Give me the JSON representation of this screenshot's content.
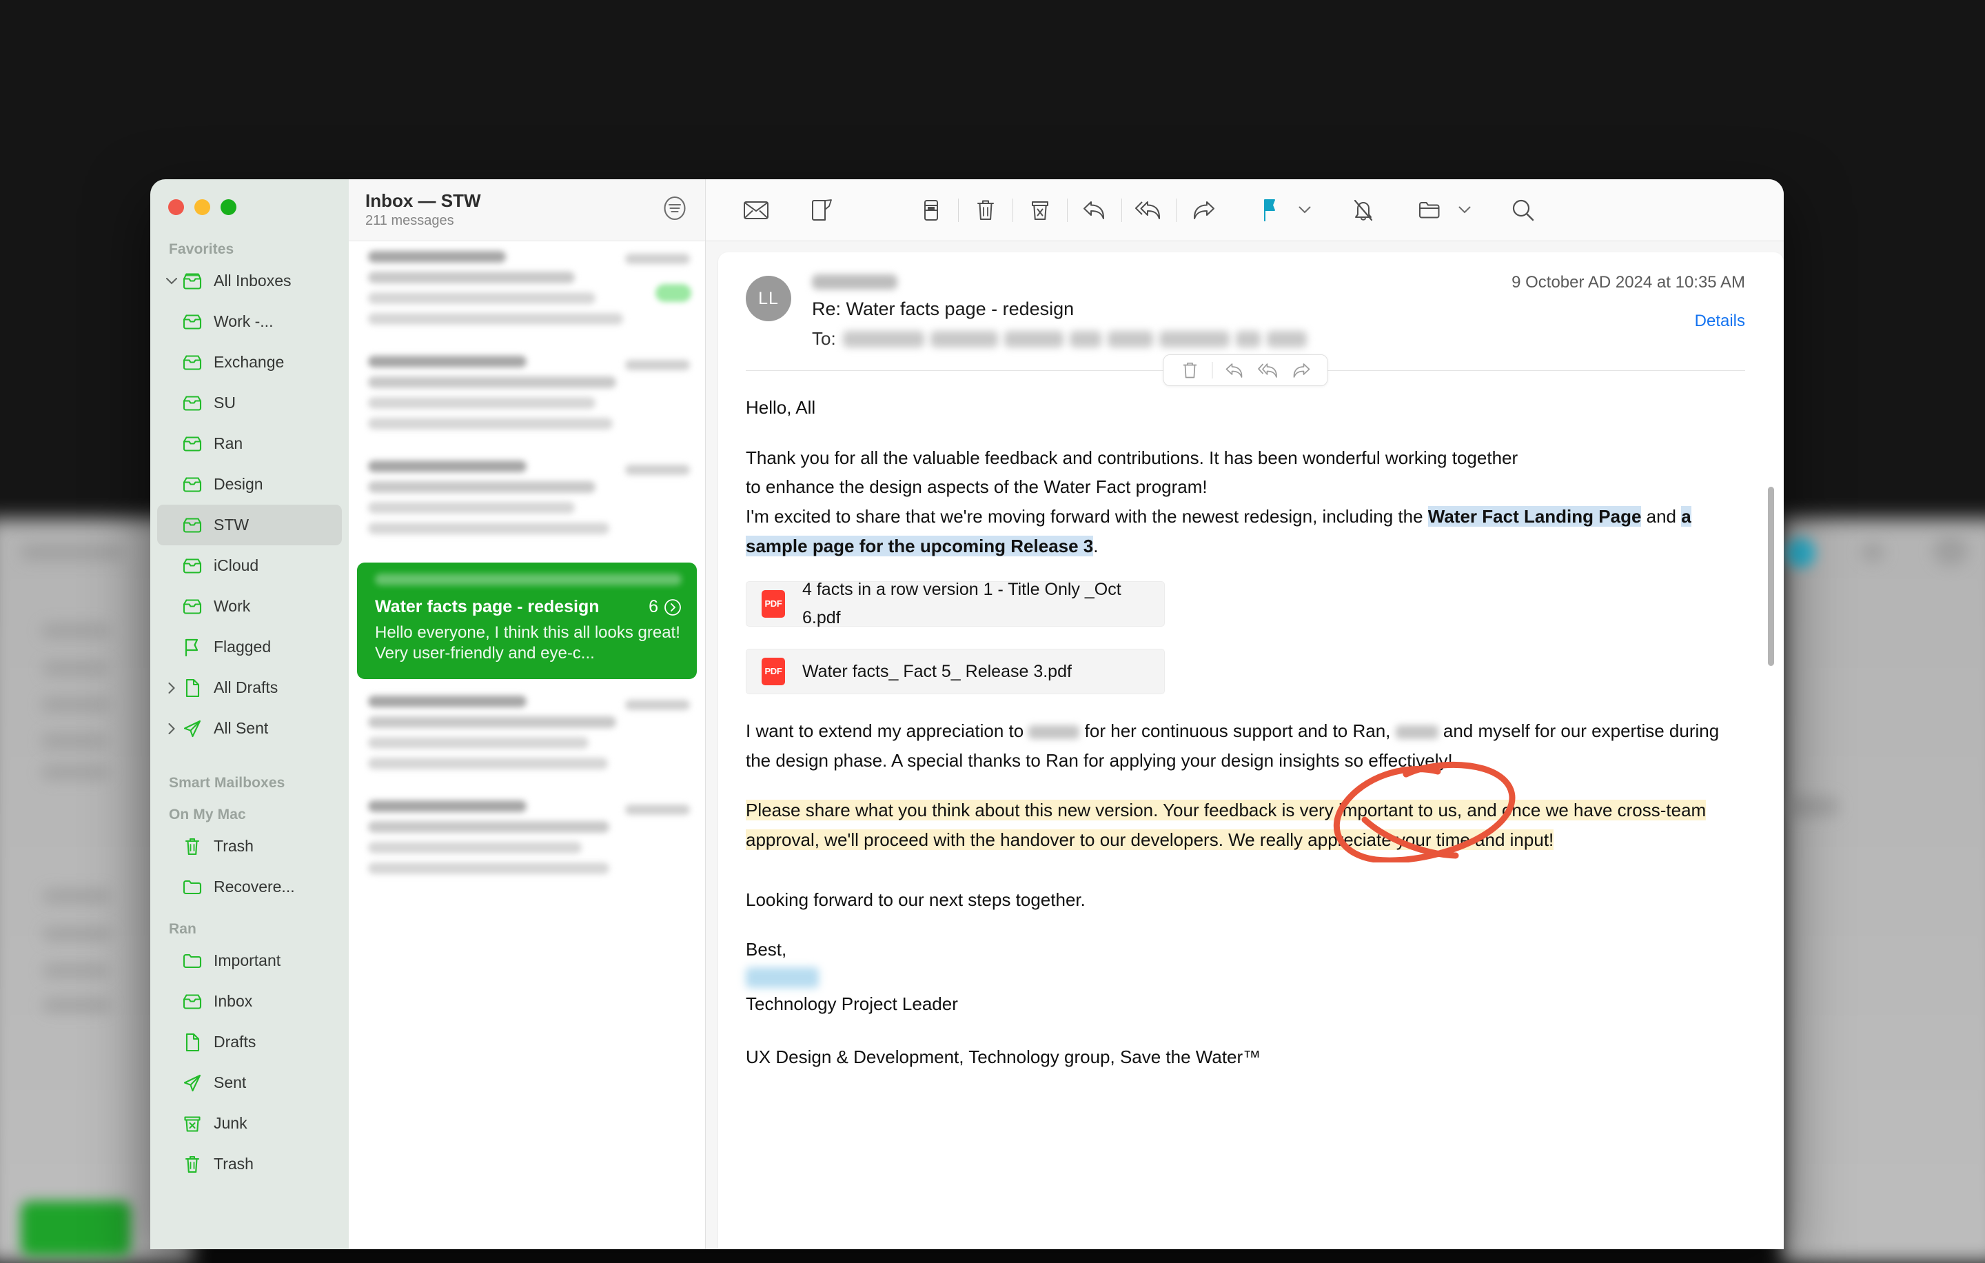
{
  "window": {
    "traffic_lights": [
      "close",
      "minimize",
      "zoom"
    ]
  },
  "sidebar": {
    "sections": [
      {
        "label": "Favorites",
        "items": [
          {
            "label": "All Inboxes",
            "icon": "inbox-icon",
            "disclosure": "chevron-down",
            "indent": 0,
            "selected": false
          },
          {
            "label": "Work -...",
            "icon": "inbox-icon",
            "disclosure": "",
            "indent": 1,
            "selected": false
          },
          {
            "label": "Exchange",
            "icon": "inbox-icon",
            "disclosure": "",
            "indent": 1,
            "selected": false
          },
          {
            "label": "SU",
            "icon": "inbox-icon",
            "disclosure": "",
            "indent": 1,
            "selected": false
          },
          {
            "label": "Ran",
            "icon": "inbox-icon",
            "disclosure": "",
            "indent": 1,
            "selected": false
          },
          {
            "label": "Design",
            "icon": "inbox-icon",
            "disclosure": "",
            "indent": 1,
            "selected": false
          },
          {
            "label": "STW",
            "icon": "inbox-icon",
            "disclosure": "",
            "indent": 1,
            "selected": true
          },
          {
            "label": "iCloud",
            "icon": "inbox-icon",
            "disclosure": "",
            "indent": 1,
            "selected": false
          },
          {
            "label": "Work",
            "icon": "inbox-icon",
            "disclosure": "",
            "indent": 1,
            "selected": false
          },
          {
            "label": "Flagged",
            "icon": "flag-icon",
            "disclosure": "",
            "indent": 0,
            "selected": false
          },
          {
            "label": "All Drafts",
            "icon": "document-icon",
            "disclosure": "chevron-right",
            "indent": 0,
            "selected": false
          },
          {
            "label": "All Sent",
            "icon": "paper-plane-icon",
            "disclosure": "chevron-right",
            "indent": 0,
            "selected": false
          }
        ]
      },
      {
        "label": "Smart Mailboxes",
        "items": []
      },
      {
        "label": "On My Mac",
        "items": [
          {
            "label": "Trash",
            "icon": "trash-icon",
            "disclosure": "",
            "indent": 0,
            "selected": false
          },
          {
            "label": "Recovere...",
            "icon": "folder-icon",
            "disclosure": "",
            "indent": 0,
            "selected": false
          }
        ]
      },
      {
        "label": "Ran",
        "items": [
          {
            "label": "Important",
            "icon": "folder-icon",
            "disclosure": "",
            "indent": 0,
            "selected": false
          },
          {
            "label": "Inbox",
            "icon": "inbox-icon",
            "disclosure": "",
            "indent": 0,
            "selected": false
          },
          {
            "label": "Drafts",
            "icon": "document-icon",
            "disclosure": "",
            "indent": 0,
            "selected": false
          },
          {
            "label": "Sent",
            "icon": "paper-plane-icon",
            "disclosure": "",
            "indent": 0,
            "selected": false
          },
          {
            "label": "Junk",
            "icon": "junk-icon",
            "disclosure": "",
            "indent": 0,
            "selected": false
          },
          {
            "label": "Trash",
            "icon": "trash-icon",
            "disclosure": "",
            "indent": 0,
            "selected": false
          }
        ]
      }
    ]
  },
  "message_list": {
    "title": "Inbox — STW",
    "subtitle": "211 messages",
    "filter_icon": "filter-icon",
    "selected_message": {
      "subject": "Water facts page - redesign",
      "thread_count": "6",
      "preview": "Hello everyone, I think this all looks great! Very user-friendly and eye-c...",
      "background_color": "#1aa524"
    }
  },
  "toolbar": {
    "buttons": [
      {
        "name": "mark-unread-icon",
        "title": "Mark as Unread"
      },
      {
        "name": "compose-icon",
        "title": "New Message"
      },
      {
        "name": "archive-icon",
        "title": "Archive"
      },
      {
        "name": "delete-icon",
        "title": "Delete"
      },
      {
        "name": "junk-icon",
        "title": "Move to Junk"
      },
      {
        "name": "reply-icon",
        "title": "Reply"
      },
      {
        "name": "reply-all-icon",
        "title": "Reply All"
      },
      {
        "name": "forward-icon",
        "title": "Forward"
      },
      {
        "name": "flag-icon",
        "title": "Flag"
      },
      {
        "name": "chevron-down-icon",
        "title": "Flag options"
      },
      {
        "name": "mute-icon",
        "title": "Mute"
      },
      {
        "name": "move-to-folder-icon",
        "title": "Move"
      },
      {
        "name": "search-icon",
        "title": "Search"
      }
    ],
    "flag_color": "#11a2c4"
  },
  "email": {
    "avatar_initials": "LL",
    "subject": "Re: Water facts page - redesign",
    "to_label": "To:",
    "timestamp": "9 October AD 2024 at 10:35 AM",
    "details_link": "Details",
    "hover_actions": [
      "delete-icon",
      "reply-icon",
      "reply-all-icon",
      "forward-icon"
    ],
    "greeting": "Hello, All",
    "para1_line1": "Thank you for all the valuable feedback and contributions. It has been wonderful working together",
    "para1_line2": "to enhance the design aspects of the Water Fact program!",
    "para2_pre": "I'm excited to share that we're moving forward with the newest redesign, including the ",
    "para2_hl1": "Water Fact Landing Page",
    "para2_mid": " and ",
    "para2_hl2": "a sample page for the upcoming Release 3",
    "para2_post": ".",
    "attachments": [
      {
        "name": "4 facts in a row version 1 - Title Only _Oct 6.pdf",
        "type": "PDF"
      },
      {
        "name": "Water facts_ Fact 5_ Release 3.pdf",
        "type": "PDF"
      }
    ],
    "para3_a": "I want to extend my appreciation to ",
    "para3_b": " for her continuous support and to Ran, ",
    "para3_c": " and myself for our expertise during the design phase. A special thanks to Ran for applying your design insights so effectively!",
    "para4_highlighted": "Please share what you think about this new version. Your feedback is very important to us, and once we have cross-team approval, we'll proceed with the handover to our developers. We really appreciate your time and input!",
    "para5": "Looking forward to our next steps together.",
    "closing": "Best,",
    "job_title": "Technology Project Leader",
    "org_line": "UX Design & Development, Technology group, Save the Water™",
    "annotation_color": "#e8553a",
    "highlight_blue": "#cfe2f3",
    "highlight_yellow": "#fdf2cd"
  }
}
